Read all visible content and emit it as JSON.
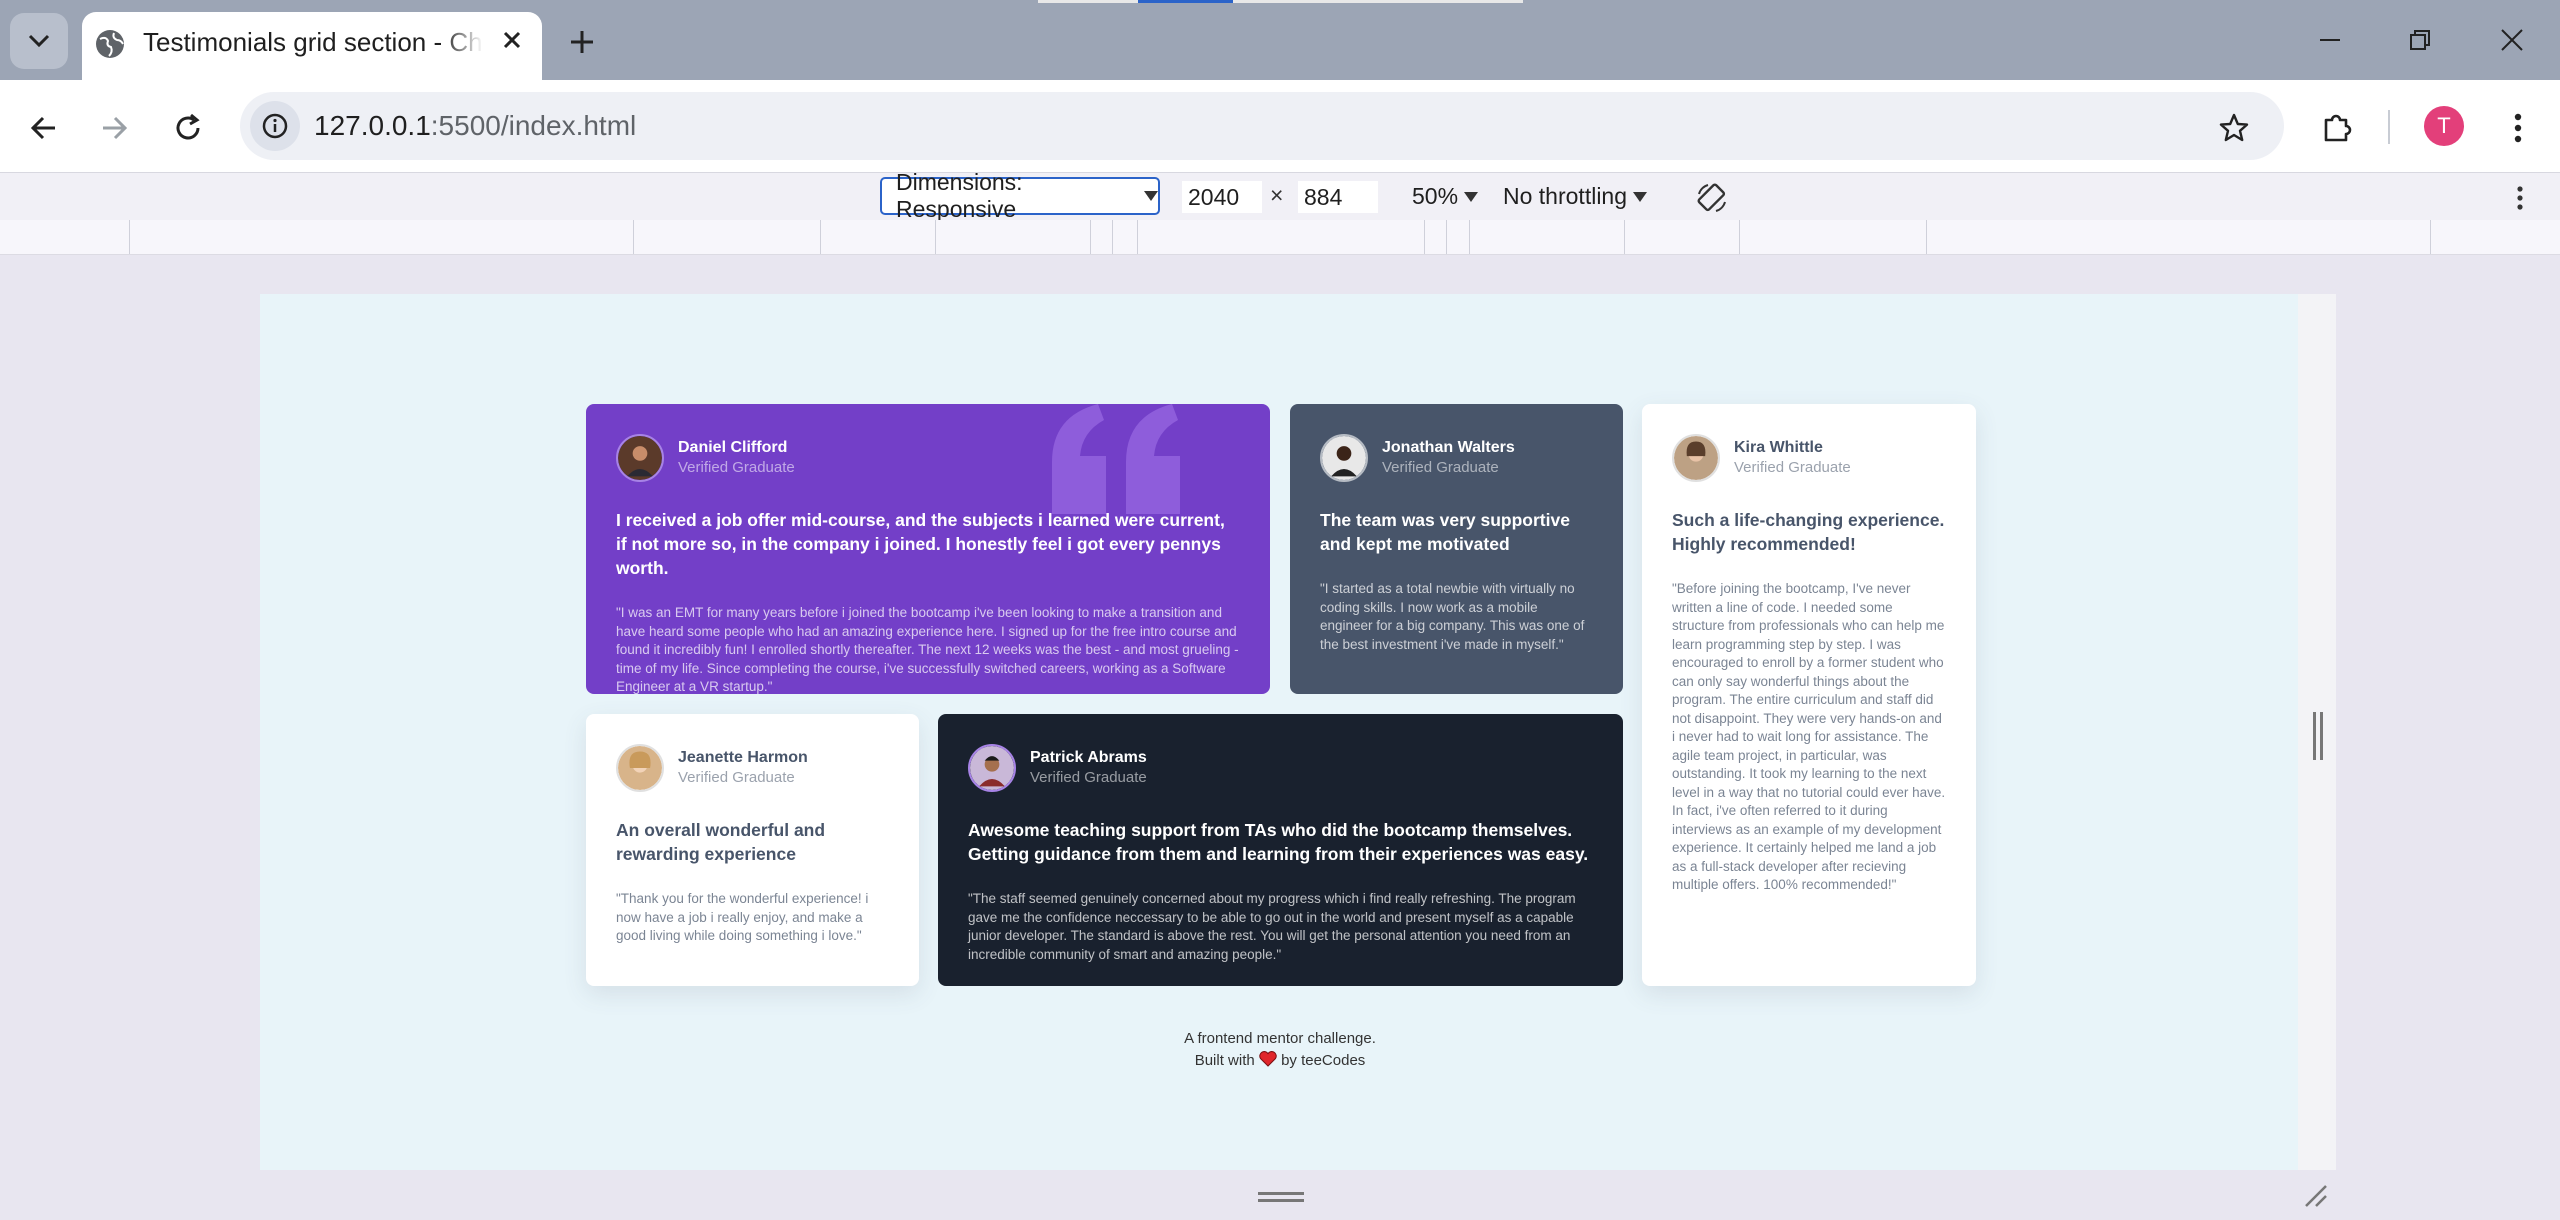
{
  "browser": {
    "tab_title": "Testimonials grid section - Challenge",
    "url_host": "127.0.0.1",
    "url_path": ":5500/index.html",
    "profile_initial": "T"
  },
  "device_toolbar": {
    "dimensions_label": "Dimensions: Responsive",
    "width": "2040",
    "times": "×",
    "height": "884",
    "zoom": "50%",
    "throttling": "No throttling"
  },
  "colors": {
    "purple": "#733fc8",
    "slate": "#48556a",
    "white": "#ffffff",
    "navy": "#19212e",
    "page_bg": "#e8f4f9"
  },
  "testimonials": [
    {
      "name": "Daniel Clifford",
      "role": "Verified Graduate",
      "lead": "I received a job offer mid-course, and the subjects i learned were current, if not more so, in the company i joined. I honestly feel i got every pennys worth.",
      "body": "\"I was an EMT for many years before i joined the bootcamp i've been looking to make a transition and have heard some people who had an amazing experience here. I signed up for the free intro course and found it incredibly fun! I enrolled shortly thereafter. The next 12 weeks was the best - and most grueling - time of my life. Since completing the course, i've successfully switched careers, working as a Software Engineer at a VR startup.\""
    },
    {
      "name": "Jonathan Walters",
      "role": "Verified Graduate",
      "lead": "The team was very supportive and kept me motivated",
      "body": "\"I started as a total newbie with virtually no coding skills. I now work as a mobile engineer for a big company. This was one of the best investment i've made in myself.\""
    },
    {
      "name": "Kira Whittle",
      "role": "Verified Graduate",
      "lead": "Such a life-changing experience. Highly recommended!",
      "body": "\"Before joining the bootcamp, I've never written a line of code. I needed some structure from professionals who can help me learn programming step by step. I was encouraged to enroll by a former student who can only say wonderful things about the program. The entire curriculum and staff did not disappoint. They were very hands-on and i never had to wait long for assistance. The agile team project, in particular, was outstanding. It took my learning to the next level in a way that no tutorial could ever have. In fact, i've often referred to it during interviews as an example of my development experience. It certainly helped me land a job as a full-stack developer after recieving multiple offers. 100% recommended!\""
    },
    {
      "name": "Jeanette Harmon",
      "role": "Verified Graduate",
      "lead": "An overall wonderful and rewarding experience",
      "body": "\"Thank you for the wonderful experience! i now have a job i really enjoy, and make a good living while doing something i love.\""
    },
    {
      "name": "Patrick Abrams",
      "role": "Verified Graduate",
      "lead": "Awesome teaching support from TAs who did the bootcamp themselves. Getting guidance from them and learning from their experiences was easy.",
      "body": "\"The staff seemed genuinely concerned about my progress which i find really refreshing. The program gave me the confidence neccessary to be able to go out in the world and present myself as a capable junior developer. The standard is above the rest. You will get the personal attention you need from an incredible community of smart and amazing people.\""
    }
  ],
  "attribution": {
    "line1": "A frontend mentor challenge.",
    "built_with": "Built with",
    "by": "by teeCodes"
  }
}
